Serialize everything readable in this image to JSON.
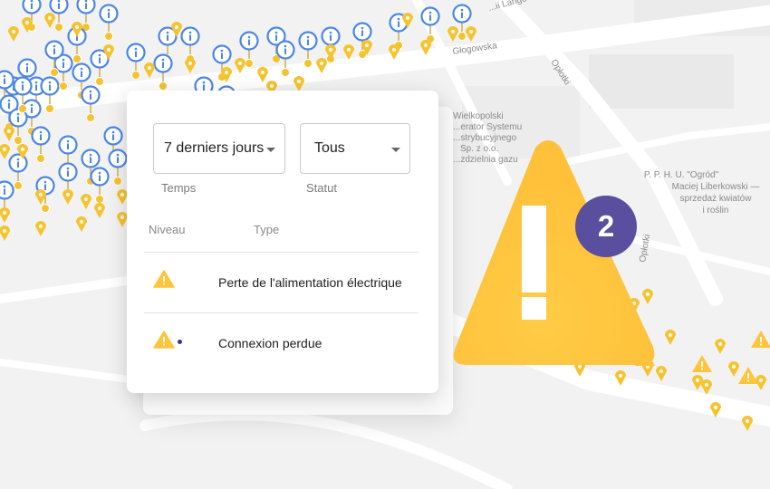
{
  "map": {
    "street_labels": [
      "...ii Lange",
      "Głogowska",
      "Opłotki",
      "Opłotki"
    ],
    "poi_labels": [
      [
        "Wielkopolski",
        "...erator Systemu",
        "...strybucyjnego",
        "Sp. z o.o.",
        "...zdzielnia gazu"
      ],
      [
        "P. P. H. U. \"Ogród\"",
        "Maciej Liberkowski —",
        "sprzedaż kwiatów",
        "i roślin"
      ]
    ],
    "colors": {
      "info_pin": "#4a86e8",
      "bulb_pin": "#f5c330",
      "warning": "#ffc43a"
    }
  },
  "filters": {
    "time": {
      "value": "7 derniers jours",
      "label": "Temps"
    },
    "status": {
      "value": "Tous",
      "label": "Statut"
    }
  },
  "table": {
    "columns": [
      "Niveau",
      "Type"
    ],
    "rows": [
      {
        "level_icon": "warning-icon",
        "type": "Perte de l'alimentation électrique",
        "unread": false
      },
      {
        "level_icon": "warning-icon",
        "type": "Connexion perdue",
        "unread": true
      }
    ]
  },
  "alert": {
    "icon": "warning-icon",
    "count": "2"
  }
}
